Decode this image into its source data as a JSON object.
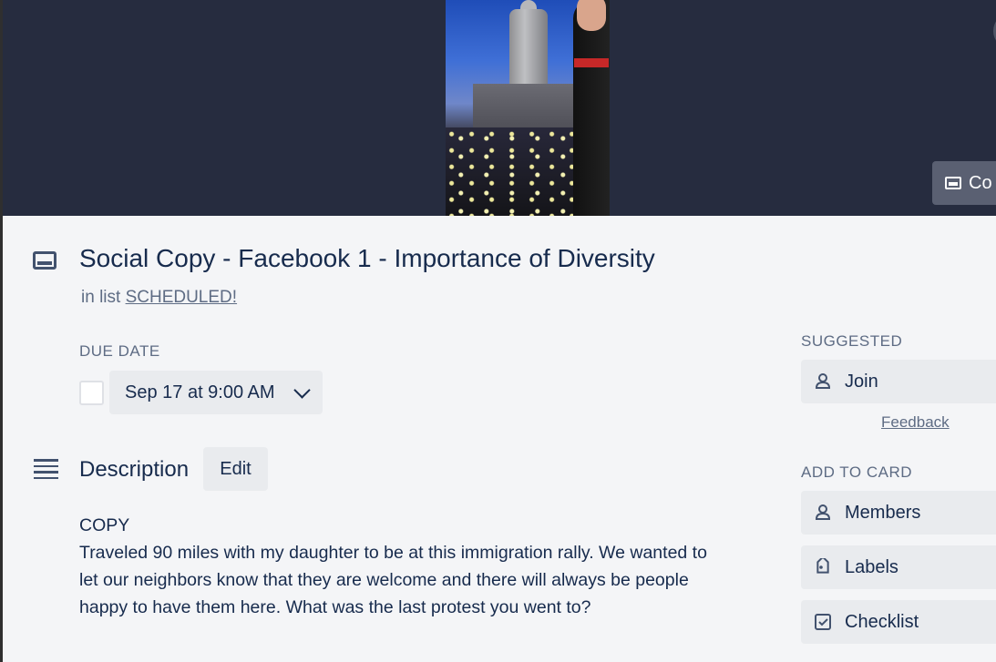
{
  "cover": {
    "button_label": "Co"
  },
  "card": {
    "title": "Social Copy - Facebook 1 - Importance of Diversity",
    "list_prefix": "in list",
    "list_name": "SCHEDULED!"
  },
  "due_date": {
    "label": "DUE DATE",
    "value": "Sep 17 at 9:00 AM"
  },
  "description": {
    "heading": "Description",
    "edit_label": "Edit",
    "lines": [
      "COPY",
      "Traveled 90 miles with my daughter to be at this immigration rally. We wanted to",
      "let our neighbors know that they are welcome and there will always be people",
      "happy to have them here. What was the last protest you went to?"
    ]
  },
  "sidebar": {
    "suggested_label": "SUGGESTED",
    "join_label": "Join",
    "feedback_label": "Feedback",
    "add_to_card_label": "ADD TO CARD",
    "items": [
      {
        "label": "Members",
        "icon": "person-icon"
      },
      {
        "label": "Labels",
        "icon": "tag-icon"
      },
      {
        "label": "Checklist",
        "icon": "checkbox-icon"
      }
    ]
  }
}
